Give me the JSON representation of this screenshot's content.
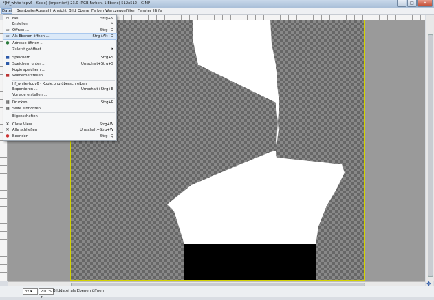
{
  "window": {
    "title": "*[hf_white-topv6 - Kopie] (importiert)-23.0 (RGB-Farben, 1 Ebene) 512x512 – GIMP",
    "buttons": {
      "minimize": "–",
      "maximize": "□",
      "close": "✕"
    }
  },
  "menubar": [
    "Datei",
    "Bearbeiten",
    "Auswahl",
    "Ansicht",
    "Bild",
    "Ebene",
    "Farben",
    "Werkzeuge",
    "Filter",
    "Fenster",
    "Hilfe"
  ],
  "file_menu": {
    "items": [
      {
        "label": "Neu ...",
        "shortcut": "Strg+N",
        "icon": "new-icon"
      },
      {
        "label": "Erstellen",
        "shortcut": "",
        "submenu": true,
        "icon": ""
      },
      {
        "label": "Öffnen ...",
        "shortcut": "Strg+O",
        "icon": "open-icon"
      },
      {
        "label": "Als Ebenen öffnen ...",
        "shortcut": "Strg+Alt+O",
        "icon": "open-layers-icon",
        "highlighted": true
      },
      {
        "label": "Adresse öffnen ...",
        "shortcut": "",
        "icon": "globe-icon"
      },
      {
        "label": "Zuletzt geöffnet",
        "shortcut": "",
        "submenu": true,
        "icon": ""
      },
      {
        "label": "Speichern",
        "shortcut": "Strg+S",
        "icon": "save-icon"
      },
      {
        "label": "Speichern unter ...",
        "shortcut": "Umschalt+Strg+S",
        "icon": "save-as-icon"
      },
      {
        "label": "Kopie speichern ...",
        "shortcut": "",
        "icon": ""
      },
      {
        "label": "Wiederherstellen",
        "shortcut": "",
        "icon": "revert-icon"
      },
      {
        "label": "hf_white-topv6 - Kopie.png überschreiben",
        "shortcut": "",
        "icon": ""
      },
      {
        "label": "Exportieren ...",
        "shortcut": "Umschalt+Strg+E",
        "icon": ""
      },
      {
        "label": "Vorlage erstellen ...",
        "shortcut": "",
        "icon": ""
      },
      {
        "label": "Drucken ...",
        "shortcut": "Strg+P",
        "icon": "print-icon"
      },
      {
        "label": "Seite einrichten",
        "shortcut": "",
        "icon": "page-setup-icon"
      },
      {
        "label": "Eigenschaften",
        "shortcut": "",
        "icon": ""
      },
      {
        "label": "Close View",
        "shortcut": "Strg+W",
        "icon": "close-icon"
      },
      {
        "label": "Alle schließen",
        "shortcut": "Umschalt+Strg+W",
        "icon": "close-icon"
      },
      {
        "label": "Beenden",
        "shortcut": "Strg+Q",
        "icon": "quit-icon"
      }
    ]
  },
  "statusbar": {
    "unit": "px",
    "zoom": "200 %",
    "message": "Bilddatei als Ebenen öffnen"
  },
  "colors": {
    "selection_border": "#d2d200",
    "menu_highlight": "#dbe9f8",
    "checker_dark": "#666666",
    "checker_light": "#888888"
  }
}
